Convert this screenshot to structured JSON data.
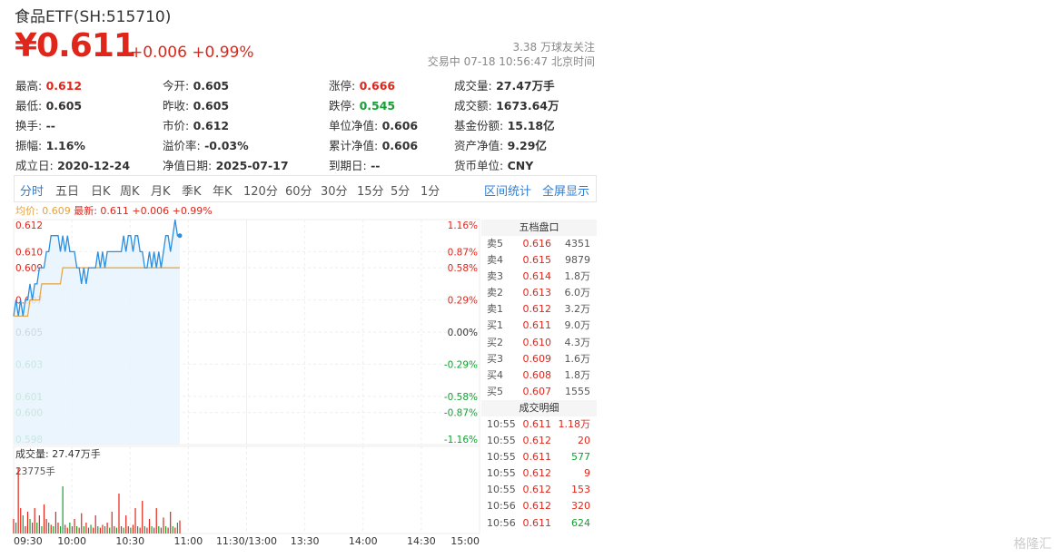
{
  "header": {
    "title": "食品ETF(SH:515710)",
    "price": "¥0.611",
    "change": "+0.006 +0.99%",
    "followers": "3.38 万球友关注",
    "status": "交易中 07-18 10:56:47 北京时间"
  },
  "stats": [
    {
      "label": "最高:",
      "value": "0.612",
      "color": "up"
    },
    {
      "label": "今开:",
      "value": "0.605",
      "color": ""
    },
    {
      "label": "涨停:",
      "value": "0.666",
      "color": "up"
    },
    {
      "label": "成交量:",
      "value": "27.47万手",
      "color": ""
    },
    {
      "label": "最低:",
      "value": "0.605",
      "color": ""
    },
    {
      "label": "昨收:",
      "value": "0.605",
      "color": ""
    },
    {
      "label": "跌停:",
      "value": "0.545",
      "color": "down"
    },
    {
      "label": "成交额:",
      "value": "1673.64万",
      "color": ""
    },
    {
      "label": "换手:",
      "value": "--",
      "color": ""
    },
    {
      "label": "市价:",
      "value": "0.612",
      "color": ""
    },
    {
      "label": "单位净值:",
      "value": "0.606",
      "color": ""
    },
    {
      "label": "基金份额:",
      "value": "15.18亿",
      "color": ""
    },
    {
      "label": "振幅:",
      "value": "1.16%",
      "color": ""
    },
    {
      "label": "溢价率:",
      "value": "-0.03%",
      "color": ""
    },
    {
      "label": "累计净值:",
      "value": "0.606",
      "color": ""
    },
    {
      "label": "资产净值:",
      "value": "9.29亿",
      "color": ""
    },
    {
      "label": "成立日:",
      "value": "2020-12-24",
      "color": ""
    },
    {
      "label": "净值日期:",
      "value": "2025-07-17",
      "color": ""
    },
    {
      "label": "到期日:",
      "value": "--",
      "color": ""
    },
    {
      "label": "货币单位:",
      "value": "CNY",
      "color": ""
    }
  ],
  "tabs": [
    "分时",
    "五日",
    "日K",
    "周K",
    "月K",
    "季K",
    "年K",
    "120分",
    "60分",
    "30分",
    "15分",
    "5分",
    "1分"
  ],
  "tab_active": "分时",
  "tab_actions": [
    "区间统计",
    "全屏显示"
  ],
  "legend": {
    "avg": "均价: 0.609",
    "last": "最新: 0.611 +0.006 +0.99%"
  },
  "volume_label": "成交量: 27.47万手",
  "volume_max_label": "23775手",
  "order_book": {
    "title": "五档盘口",
    "rows": [
      {
        "label": "卖5",
        "price": "0.616",
        "qty": "4351"
      },
      {
        "label": "卖4",
        "price": "0.615",
        "qty": "9879"
      },
      {
        "label": "卖3",
        "price": "0.614",
        "qty": "1.8万"
      },
      {
        "label": "卖2",
        "price": "0.613",
        "qty": "6.0万"
      },
      {
        "label": "卖1",
        "price": "0.612",
        "qty": "3.2万"
      },
      {
        "label": "买1",
        "price": "0.611",
        "qty": "9.0万"
      },
      {
        "label": "买2",
        "price": "0.610",
        "qty": "4.3万"
      },
      {
        "label": "买3",
        "price": "0.609",
        "qty": "1.6万"
      },
      {
        "label": "买4",
        "price": "0.608",
        "qty": "1.8万"
      },
      {
        "label": "买5",
        "price": "0.607",
        "qty": "1555"
      }
    ]
  },
  "trades": {
    "title": "成交明细",
    "rows": [
      {
        "time": "10:55",
        "price": "0.611",
        "qty": "1.18万",
        "dir": "up"
      },
      {
        "time": "10:55",
        "price": "0.612",
        "qty": "20",
        "dir": "up"
      },
      {
        "time": "10:55",
        "price": "0.611",
        "qty": "577",
        "dir": "down"
      },
      {
        "time": "10:55",
        "price": "0.612",
        "qty": "9",
        "dir": "up"
      },
      {
        "time": "10:55",
        "price": "0.612",
        "qty": "153",
        "dir": "up"
      },
      {
        "time": "10:56",
        "price": "0.612",
        "qty": "320",
        "dir": "up"
      },
      {
        "time": "10:56",
        "price": "0.611",
        "qty": "624",
        "dir": "down"
      }
    ]
  },
  "colors": {
    "up": "#e0261b",
    "down": "#14a033",
    "price_line": "#2a8fe0",
    "avg_line": "#e6a23c",
    "accent": "#2c7fd9"
  },
  "watermark": "格隆汇",
  "chart_data": {
    "type": "line",
    "ylim": [
      0.598,
      0.612
    ],
    "y_ticks": [
      "0.612",
      "0.610",
      "0.609",
      "0.607",
      "0.605",
      "0.603",
      "0.601",
      "0.600",
      "0.598"
    ],
    "pct_ticks": [
      "1.16%",
      "0.87%",
      "0.58%",
      "0.29%",
      "0.00%",
      "-0.29%",
      "-0.58%",
      "-0.87%",
      "-1.16%"
    ],
    "x_ticks": [
      "09:30",
      "10:00",
      "10:30",
      "11:00",
      "11:30/13:00",
      "13:30",
      "14:00",
      "14:30",
      "15:00"
    ],
    "series": [
      {
        "values": [
          0.606,
          0.607,
          0.606,
          0.607,
          0.606,
          0.607,
          0.607,
          0.608,
          0.607,
          0.608,
          0.608,
          0.609,
          0.609,
          0.609,
          0.61,
          0.61,
          0.611,
          0.611,
          0.611,
          0.611,
          0.61,
          0.611,
          0.61,
          0.611,
          0.61,
          0.61,
          0.61,
          0.609,
          0.609,
          0.608,
          0.609,
          0.608,
          0.609,
          0.609,
          0.609,
          0.609,
          0.61,
          0.609,
          0.61,
          0.609,
          0.61,
          0.61,
          0.61,
          0.61,
          0.61,
          0.61,
          0.61,
          0.611,
          0.61,
          0.611,
          0.611,
          0.61,
          0.611,
          0.611,
          0.61,
          0.61,
          0.609,
          0.609,
          0.61,
          0.609,
          0.61,
          0.609,
          0.61,
          0.609,
          0.61,
          0.611,
          0.611,
          0.61,
          0.611,
          0.612,
          0.611,
          0.611
        ]
      },
      {
        "values": [
          0.606,
          0.606,
          0.606,
          0.606,
          0.606,
          0.606,
          0.606,
          0.607,
          0.607,
          0.607,
          0.607,
          0.607,
          0.608,
          0.608,
          0.608,
          0.608,
          0.608,
          0.608,
          0.608,
          0.608,
          0.608,
          0.609,
          0.609,
          0.609,
          0.609,
          0.609,
          0.609,
          0.609,
          0.609,
          0.609,
          0.609,
          0.609,
          0.609,
          0.609,
          0.609,
          0.609,
          0.609,
          0.609,
          0.609,
          0.609,
          0.609,
          0.609,
          0.609,
          0.609,
          0.609,
          0.609,
          0.609,
          0.609,
          0.609,
          0.609,
          0.609,
          0.609,
          0.609,
          0.609,
          0.609,
          0.609,
          0.609,
          0.609,
          0.609,
          0.609,
          0.609,
          0.609,
          0.609,
          0.609,
          0.609,
          0.609,
          0.609,
          0.609,
          0.609,
          0.609,
          0.609,
          0.609
        ]
      }
    ],
    "volume": [
      0.2,
      0.15,
      0.9,
      0.35,
      0.25,
      0.1,
      0.3,
      0.2,
      0.15,
      0.35,
      0.15,
      0.25,
      0.1,
      0.4,
      0.2,
      0.15,
      0.12,
      0.1,
      0.3,
      0.15,
      0.1,
      0.65,
      0.12,
      0.08,
      0.15,
      0.1,
      0.2,
      0.1,
      0.08,
      0.28,
      0.1,
      0.15,
      0.08,
      0.12,
      0.08,
      0.25,
      0.1,
      0.08,
      0.12,
      0.1,
      0.15,
      0.08,
      0.3,
      0.1,
      0.08,
      0.55,
      0.1,
      0.08,
      0.25,
      0.1,
      0.08,
      0.12,
      0.35,
      0.1,
      0.08,
      0.45,
      0.1,
      0.08,
      0.2,
      0.1,
      0.08,
      0.35,
      0.1,
      0.08,
      0.22,
      0.1,
      0.08,
      0.3,
      0.1,
      0.08,
      0.15,
      0.18
    ],
    "volume_dir": [
      "u",
      "d",
      "u",
      "u",
      "d",
      "u",
      "u",
      "d",
      "u",
      "u",
      "d",
      "u",
      "d",
      "u",
      "u",
      "d",
      "u",
      "d",
      "u",
      "u",
      "d",
      "d",
      "u",
      "u",
      "d",
      "u",
      "u",
      "d",
      "u",
      "u",
      "d",
      "u",
      "u",
      "d",
      "u",
      "u",
      "d",
      "u",
      "u",
      "d",
      "u",
      "d",
      "u",
      "u",
      "d",
      "u",
      "u",
      "d",
      "u",
      "u",
      "d",
      "u",
      "u",
      "d",
      "u",
      "u",
      "d",
      "u",
      "u",
      "d",
      "u",
      "u",
      "d",
      "u",
      "u",
      "d",
      "u",
      "u",
      "d",
      "u",
      "d",
      "u"
    ]
  }
}
